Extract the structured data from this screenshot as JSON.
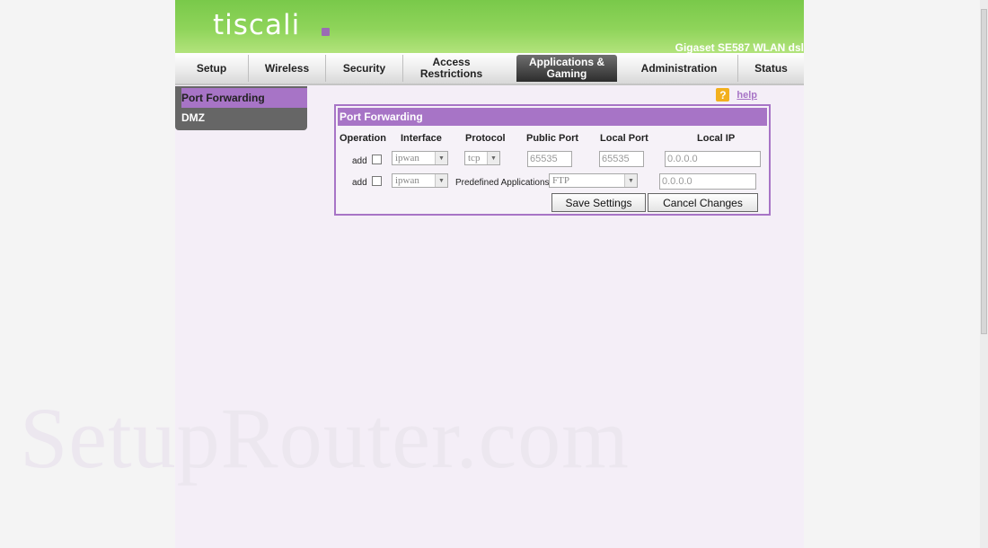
{
  "brand": {
    "logo": "tiscali",
    "model": "Gigaset SE587 WLAN dsl"
  },
  "nav": {
    "tabs": [
      {
        "label": "Setup"
      },
      {
        "label": "Wireless"
      },
      {
        "label": "Security"
      },
      {
        "label": "Access Restrictions"
      },
      {
        "label": "Applications & Gaming"
      },
      {
        "label": "Administration"
      },
      {
        "label": "Status"
      }
    ]
  },
  "sidebar": {
    "items": [
      {
        "label": "Port Forwarding"
      },
      {
        "label": "DMZ"
      }
    ]
  },
  "help": {
    "icon": "?",
    "label": "help"
  },
  "panel": {
    "title": "Port Forwarding",
    "columns": [
      "Operation",
      "Interface",
      "Protocol",
      "Public Port",
      "Local Port",
      "Local IP"
    ],
    "row1": {
      "op_label": "add",
      "interface": "ipwan",
      "protocol": "tcp",
      "public_port": "65535",
      "local_port": "65535",
      "local_ip": "0.0.0.0"
    },
    "row2": {
      "op_label": "add",
      "interface": "ipwan",
      "predefined_label": "Predefined Applications:",
      "predefined_value": "FTP",
      "local_ip": "0.0.0.0"
    },
    "save_label": "Save Settings",
    "cancel_label": "Cancel Changes"
  },
  "watermark": "SetupRouter.com",
  "colors": {
    "header_green": "#8fd45a",
    "accent_purple": "#a774c6",
    "sidebar_gray": "#666666"
  }
}
